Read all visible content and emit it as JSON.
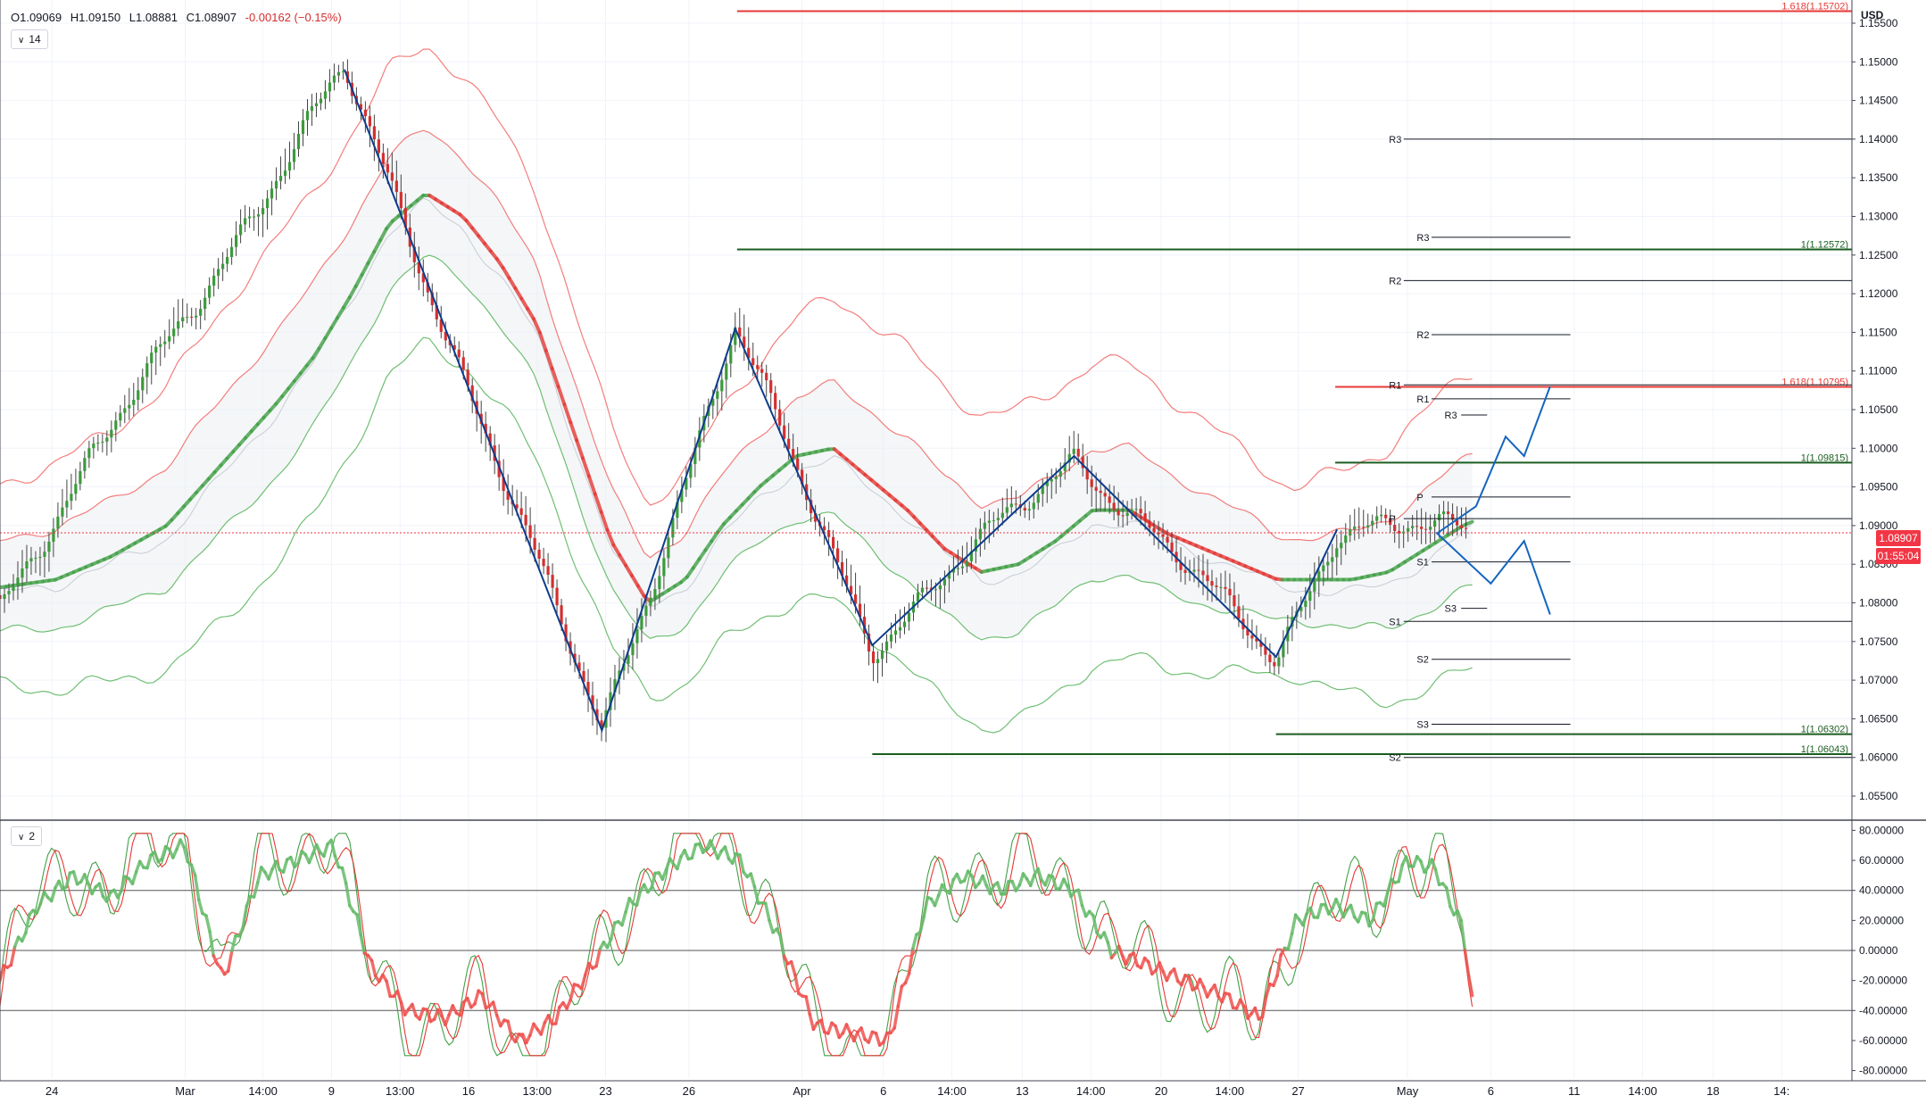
{
  "symbol_ohlc": {
    "open": "O1.09069",
    "high": "H1.09150",
    "low": "L1.08881",
    "close": "C1.08907",
    "change": "-0.00162 (−0.15%)"
  },
  "panes": {
    "price_badge": "14",
    "oscillator_badge": "2"
  },
  "axis": {
    "currency": "USD",
    "price_ticks": [
      "1.15500",
      "1.15000",
      "1.14500",
      "1.14000",
      "1.13500",
      "1.13000",
      "1.12500",
      "1.12000",
      "1.11500",
      "1.11000",
      "1.10500",
      "1.10000",
      "1.09500",
      "1.09000",
      "1.08500",
      "1.08000",
      "1.07500",
      "1.07000",
      "1.06500",
      "1.06000",
      "1.05500"
    ],
    "osc_ticks": [
      "80.00000",
      "60.00000",
      "40.00000",
      "20.00000",
      "0.00000",
      "-20.00000",
      "-40.00000",
      "-60.00000",
      "-80.00000"
    ],
    "time_ticks": [
      "24",
      "Mar",
      "14:00",
      "9",
      "13:00",
      "16",
      "13:00",
      "23",
      "26",
      "Apr",
      "6",
      "14:00",
      "13",
      "14:00",
      "20",
      "14:00",
      "27",
      "May",
      "6",
      "11",
      "14:00",
      "18",
      "14:"
    ]
  },
  "current_price": {
    "label": "1.08907",
    "countdown": "01:55:04",
    "color": "#f23645"
  },
  "fib_labels": [
    {
      "text": "1.618(1.15702)",
      "color": "#e53935"
    },
    {
      "text": "1(1.12572)",
      "color": "#1b5e20"
    },
    {
      "text": "1.618(1.10795)",
      "color": "#e53935"
    },
    {
      "text": "1(1.09815)",
      "color": "#1b5e20"
    },
    {
      "text": "1(1.06302)",
      "color": "#1b5e20"
    },
    {
      "text": "1(1.06043)",
      "color": "#1b5e20"
    }
  ],
  "pivot_labels": [
    "R3",
    "R2",
    "R1",
    "P",
    "S1",
    "S2",
    "S3",
    "R3",
    "R2",
    "R1",
    "P",
    "S1",
    "S2",
    "S3",
    "R3",
    "S3",
    "P"
  ],
  "chart_data": {
    "type": "line",
    "title": "",
    "price_range": [
      1.052,
      1.158
    ],
    "oscillator_range": [
      -85,
      85
    ],
    "levels": {
      "fib_1618_high": 1.15702,
      "fib_1_upper": 1.12572,
      "fib_1618_mid": 1.10795,
      "fib_1_mid": 1.09815,
      "fib_1_low_a": 1.06302,
      "fib_1_low_b": 1.06043,
      "current": 1.08907,
      "monthly_pivots": {
        "R3": 1.14,
        "R2": 1.1217,
        "R1": 1.1082,
        "P": 1.0909,
        "S1": 1.0776,
        "S2": 1.06
      },
      "weekly_pivots": {
        "R3": 1.1273,
        "R2": 1.1147,
        "R1": 1.1064,
        "P": 1.0937,
        "S1": 1.0853,
        "S2": 1.0727,
        "S3": 1.0643
      },
      "daily_pivots": {
        "R3": 1.1043,
        "R1": 1.0932,
        "S3": 1.0793
      }
    },
    "zigzag": [
      {
        "t": 0.186,
        "p": 1.149
      },
      {
        "t": 0.325,
        "p": 1.0635
      },
      {
        "t": 0.397,
        "p": 1.1155
      },
      {
        "t": 0.471,
        "p": 1.0745
      },
      {
        "t": 0.58,
        "p": 1.099
      },
      {
        "t": 0.689,
        "p": 1.073
      },
      {
        "t": 0.722,
        "p": 1.0895
      }
    ],
    "projection_up": [
      {
        "t": 0.797,
        "p": 1.0925
      },
      {
        "t": 0.813,
        "p": 1.1015
      },
      {
        "t": 0.823,
        "p": 1.099
      },
      {
        "t": 0.837,
        "p": 1.108
      }
    ],
    "projection_down": [
      {
        "t": 0.776,
        "p": 1.089
      },
      {
        "t": 0.805,
        "p": 1.0825
      },
      {
        "t": 0.823,
        "p": 1.088
      },
      {
        "t": 0.837,
        "p": 1.0785
      }
    ],
    "basis_series": [
      [
        0.0,
        1.082
      ],
      [
        0.03,
        1.083
      ],
      [
        0.06,
        1.086
      ],
      [
        0.09,
        1.09
      ],
      [
        0.12,
        1.098
      ],
      [
        0.15,
        1.106
      ],
      [
        0.17,
        1.112
      ],
      [
        0.19,
        1.12
      ],
      [
        0.21,
        1.129
      ],
      [
        0.23,
        1.133
      ],
      [
        0.25,
        1.13
      ],
      [
        0.27,
        1.124
      ],
      [
        0.29,
        1.116
      ],
      [
        0.31,
        1.102
      ],
      [
        0.33,
        1.088
      ],
      [
        0.35,
        1.08
      ],
      [
        0.37,
        1.083
      ],
      [
        0.39,
        1.09
      ],
      [
        0.41,
        1.095
      ],
      [
        0.43,
        1.099
      ],
      [
        0.45,
        1.1
      ],
      [
        0.47,
        1.096
      ],
      [
        0.49,
        1.092
      ],
      [
        0.51,
        1.087
      ],
      [
        0.53,
        1.084
      ],
      [
        0.55,
        1.085
      ],
      [
        0.57,
        1.088
      ],
      [
        0.59,
        1.092
      ],
      [
        0.61,
        1.092
      ],
      [
        0.63,
        1.089
      ],
      [
        0.65,
        1.087
      ],
      [
        0.67,
        1.085
      ],
      [
        0.69,
        1.083
      ],
      [
        0.71,
        1.083
      ],
      [
        0.73,
        1.083
      ],
      [
        0.75,
        1.084
      ],
      [
        0.77,
        1.087
      ],
      [
        0.79,
        1.09
      ],
      [
        0.795,
        1.0905
      ]
    ],
    "oscillator_main": [
      [
        0.0,
        -20
      ],
      [
        0.02,
        30
      ],
      [
        0.04,
        50
      ],
      [
        0.06,
        35
      ],
      [
        0.08,
        60
      ],
      [
        0.1,
        70
      ],
      [
        0.12,
        -20
      ],
      [
        0.14,
        50
      ],
      [
        0.16,
        60
      ],
      [
        0.18,
        70
      ],
      [
        0.2,
        -10
      ],
      [
        0.22,
        -40
      ],
      [
        0.24,
        -45
      ],
      [
        0.26,
        -30
      ],
      [
        0.28,
        -60
      ],
      [
        0.3,
        -45
      ],
      [
        0.32,
        -10
      ],
      [
        0.34,
        30
      ],
      [
        0.36,
        55
      ],
      [
        0.38,
        70
      ],
      [
        0.4,
        60
      ],
      [
        0.42,
        10
      ],
      [
        0.44,
        -50
      ],
      [
        0.46,
        -55
      ],
      [
        0.48,
        -60
      ],
      [
        0.5,
        30
      ],
      [
        0.52,
        50
      ],
      [
        0.54,
        40
      ],
      [
        0.56,
        50
      ],
      [
        0.58,
        40
      ],
      [
        0.6,
        0
      ],
      [
        0.62,
        -10
      ],
      [
        0.64,
        -20
      ],
      [
        0.66,
        -30
      ],
      [
        0.68,
        -45
      ],
      [
        0.7,
        20
      ],
      [
        0.72,
        30
      ],
      [
        0.74,
        20
      ],
      [
        0.76,
        60
      ],
      [
        0.775,
        55
      ],
      [
        0.78,
        40
      ],
      [
        0.79,
        15
      ],
      [
        0.795,
        -35
      ]
    ]
  }
}
